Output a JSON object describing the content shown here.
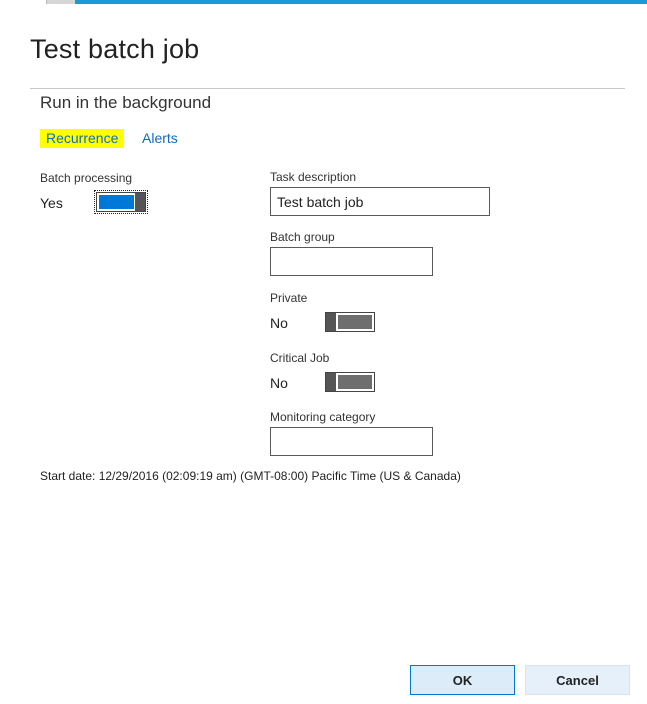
{
  "dialog": {
    "title": "Test batch job",
    "section_heading": "Run in the background"
  },
  "tabs": [
    {
      "label": "Recurrence",
      "highlighted": true
    },
    {
      "label": "Alerts",
      "highlighted": false
    }
  ],
  "batch_processing": {
    "label": "Batch processing",
    "value_text": "Yes",
    "on": true
  },
  "task_description": {
    "label": "Task description",
    "value": "Test batch job"
  },
  "batch_group": {
    "label": "Batch group",
    "value": ""
  },
  "private": {
    "label": "Private",
    "value_text": "No",
    "on": false
  },
  "critical_job": {
    "label": "Critical Job",
    "value_text": "No",
    "on": false
  },
  "monitoring_category": {
    "label": "Monitoring category",
    "value": ""
  },
  "start_date_text": "Start date: 12/29/2016 (02:09:19 am) (GMT-08:00) Pacific Time (US & Canada)",
  "buttons": {
    "ok_label": "OK",
    "cancel_label": "Cancel"
  },
  "colors": {
    "accent": "#0078d7",
    "link": "#0f6cbd",
    "highlight": "#ffff00",
    "top_strip": "#1a9ad6"
  }
}
